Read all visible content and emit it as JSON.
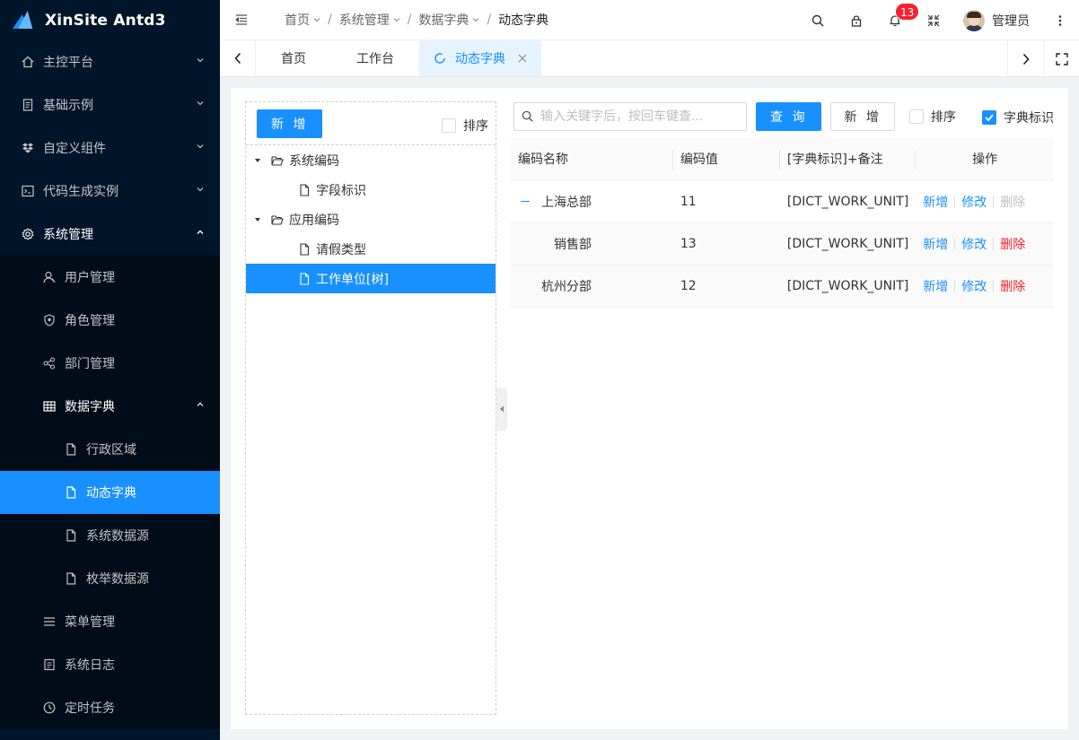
{
  "app": {
    "title": "XinSite Antd3"
  },
  "sidebar": {
    "items": [
      {
        "label": "主控平台",
        "icon": "home-icon"
      },
      {
        "label": "基础示例",
        "icon": "file-text-icon"
      },
      {
        "label": "自定义组件",
        "icon": "dropbox-icon"
      },
      {
        "label": "代码生成实例",
        "icon": "code-icon"
      },
      {
        "label": "系统管理",
        "icon": "setting-icon"
      }
    ],
    "system": [
      {
        "label": "用户管理",
        "icon": "user-icon"
      },
      {
        "label": "角色管理",
        "icon": "safety-icon"
      },
      {
        "label": "部门管理",
        "icon": "cluster-icon"
      },
      {
        "label": "数据字典",
        "icon": "table-icon"
      },
      {
        "label": "菜单管理",
        "icon": "menu-icon"
      },
      {
        "label": "系统日志",
        "icon": "log-icon"
      },
      {
        "label": "定时任务",
        "icon": "clock-icon"
      }
    ],
    "dict": [
      {
        "label": "行政区域",
        "icon": "file-icon"
      },
      {
        "label": "动态字典",
        "icon": "file-icon"
      },
      {
        "label": "系统数据源",
        "icon": "file-icon"
      },
      {
        "label": "枚举数据源",
        "icon": "file-icon"
      }
    ]
  },
  "header": {
    "breadcrumb": [
      "首页",
      "系统管理",
      "数据字典",
      "动态字典"
    ],
    "notifications": "13",
    "user": "管理员"
  },
  "tabs": [
    "首页",
    "工作台",
    "动态字典"
  ],
  "left": {
    "add_label": "新 增",
    "sort_label": "排序",
    "tree": [
      {
        "label": "系统编码"
      },
      {
        "label": "字段标识"
      },
      {
        "label": "应用编码"
      },
      {
        "label": "请假类型"
      },
      {
        "label": "工作单位[树]"
      }
    ]
  },
  "right": {
    "search_placeholder": "输入关键字后，按回车键查...",
    "query_label": "查 询",
    "add_label": "新 增",
    "sort_label": "排序",
    "dict_flag_label": "字典标识",
    "columns": [
      "编码名称",
      "编码值",
      "[字典标识]+备注",
      "操作"
    ],
    "rows": [
      {
        "name": "上海总部",
        "value": "11",
        "remark": "[DICT_WORK_UNIT]"
      },
      {
        "name": "销售部",
        "value": "13",
        "remark": "[DICT_WORK_UNIT]"
      },
      {
        "name": "杭州分部",
        "value": "12",
        "remark": "[DICT_WORK_UNIT]"
      }
    ],
    "ops": {
      "add": "新增",
      "edit": "修改",
      "delete": "删除"
    }
  }
}
